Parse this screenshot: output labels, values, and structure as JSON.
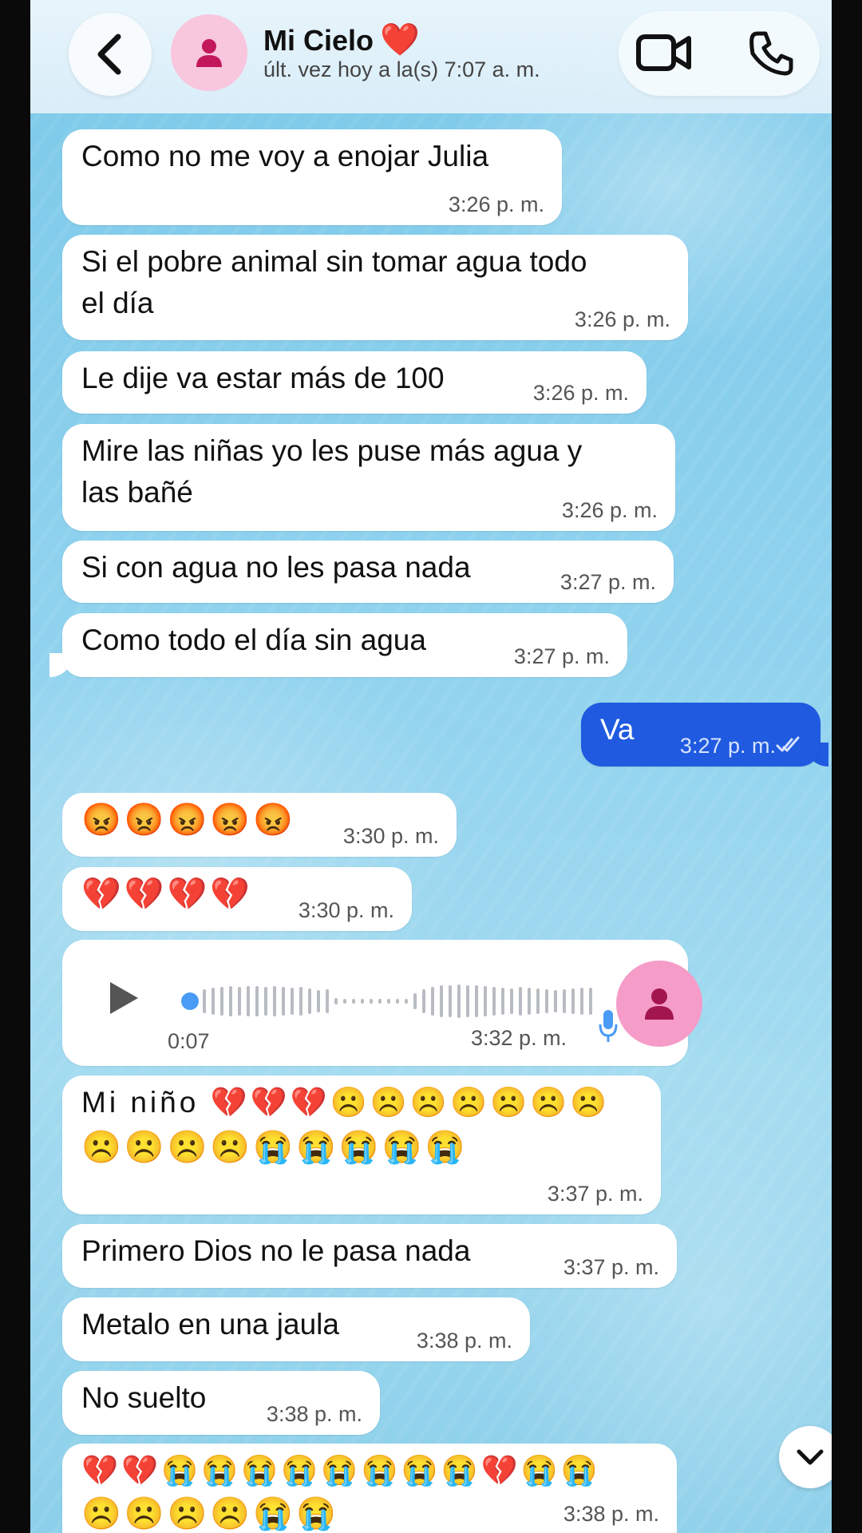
{
  "header": {
    "contact_name": "Mi Cielo",
    "contact_name_emoji": "❤️",
    "status": "últ. vez hoy a la(s) 7:07 a. m.",
    "icons": {
      "back": "chevron-left-icon",
      "avatar": "person-icon",
      "video": "video-camera-icon",
      "phone": "phone-icon"
    }
  },
  "messages": [
    {
      "dir": "in",
      "text": "Como no me voy a enojar Julia",
      "time": "3:26 p. m."
    },
    {
      "dir": "in",
      "text": "Si el pobre animal sin tomar agua todo",
      "text2": "el día",
      "time": "3:26 p. m."
    },
    {
      "dir": "in",
      "text": "Le dije va estar más de 100",
      "time": "3:26 p. m."
    },
    {
      "dir": "in",
      "text": "Mire las niñas yo les puse más agua y",
      "text2": "las bañé",
      "time": "3:26 p. m."
    },
    {
      "dir": "in",
      "text": "Si con agua no les pasa nada",
      "time": "3:27 p. m."
    },
    {
      "dir": "in",
      "text": "Como todo el día sin agua",
      "time": "3:27 p. m."
    },
    {
      "dir": "out",
      "text": "Va",
      "time": "3:27 p. m.",
      "status_icon": "double-check-icon"
    },
    {
      "dir": "in",
      "text": "😡😡😡😡😡",
      "time": "3:30 p. m."
    },
    {
      "dir": "in",
      "text": "💔💔💔💔",
      "time": "3:30 p. m."
    },
    {
      "dir": "in",
      "type": "voice",
      "duration": "0:07",
      "time": "3:32 p. m.",
      "progress": 0
    },
    {
      "dir": "in",
      "text": "Mi niño 💔💔💔☹️☹️☹️☹️☹️☹️☹️",
      "text2": "☹️☹️☹️☹️😭😭😭😭😭",
      "time": "3:37 p. m."
    },
    {
      "dir": "in",
      "text": "Primero Dios no le pasa nada",
      "time": "3:37 p. m."
    },
    {
      "dir": "in",
      "text": "Metalo en una jaula",
      "time": "3:38 p. m."
    },
    {
      "dir": "in",
      "text": "No suelto",
      "time": "3:38 p. m."
    },
    {
      "dir": "in",
      "text": "💔💔😭😭😭😭😭😭😭😭💔😭😭",
      "text2": "☹️☹️☹️☹️😭😭",
      "time": "3:38 p. m."
    }
  ],
  "scroll_down_icon": "chevron-down-icon",
  "colors": {
    "outgoing": "#1f5ae0",
    "incoming": "#ffffff",
    "accent_pink": "#f59cc8"
  }
}
